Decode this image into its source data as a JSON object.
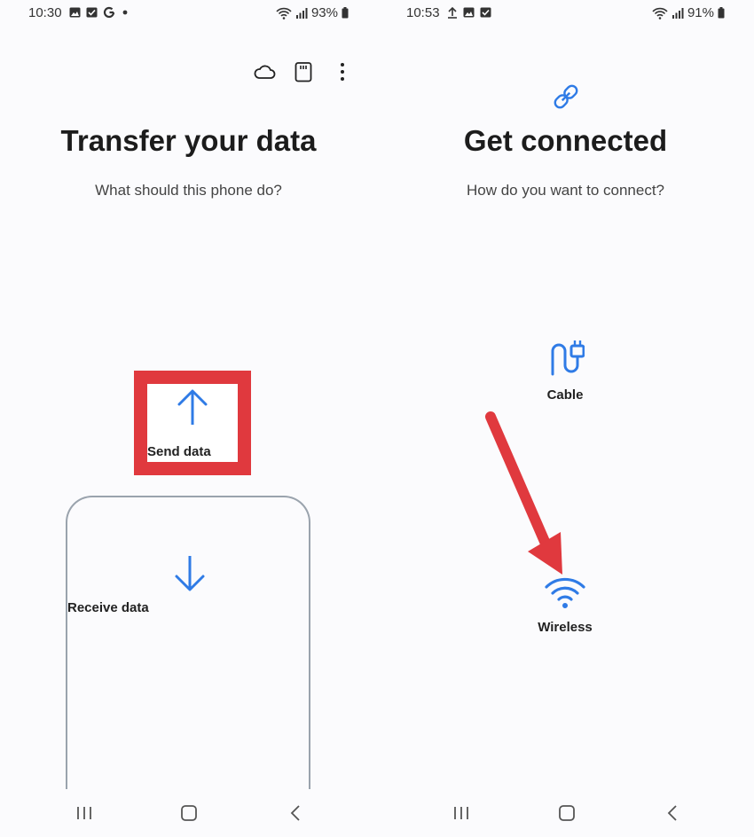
{
  "left_screen": {
    "status": {
      "time": "10:30",
      "battery": "93%"
    },
    "toolbar": {
      "icons": [
        "cloud-icon",
        "sd-card-icon",
        "more-vertical-icon"
      ]
    },
    "title": "Transfer your data",
    "subtitle": "What should this phone do?",
    "send_label": "Send data",
    "receive_label": "Receive data"
  },
  "right_screen": {
    "status": {
      "time": "10:53",
      "battery": "91%"
    },
    "header_icon": "link-icon",
    "title": "Get connected",
    "subtitle": "How do you want to connect?",
    "cable_label": "Cable",
    "wireless_label": "Wireless"
  },
  "colors": {
    "accent": "#2f7be6",
    "highlight": "#e0393e",
    "text": "#1c1c1c"
  }
}
